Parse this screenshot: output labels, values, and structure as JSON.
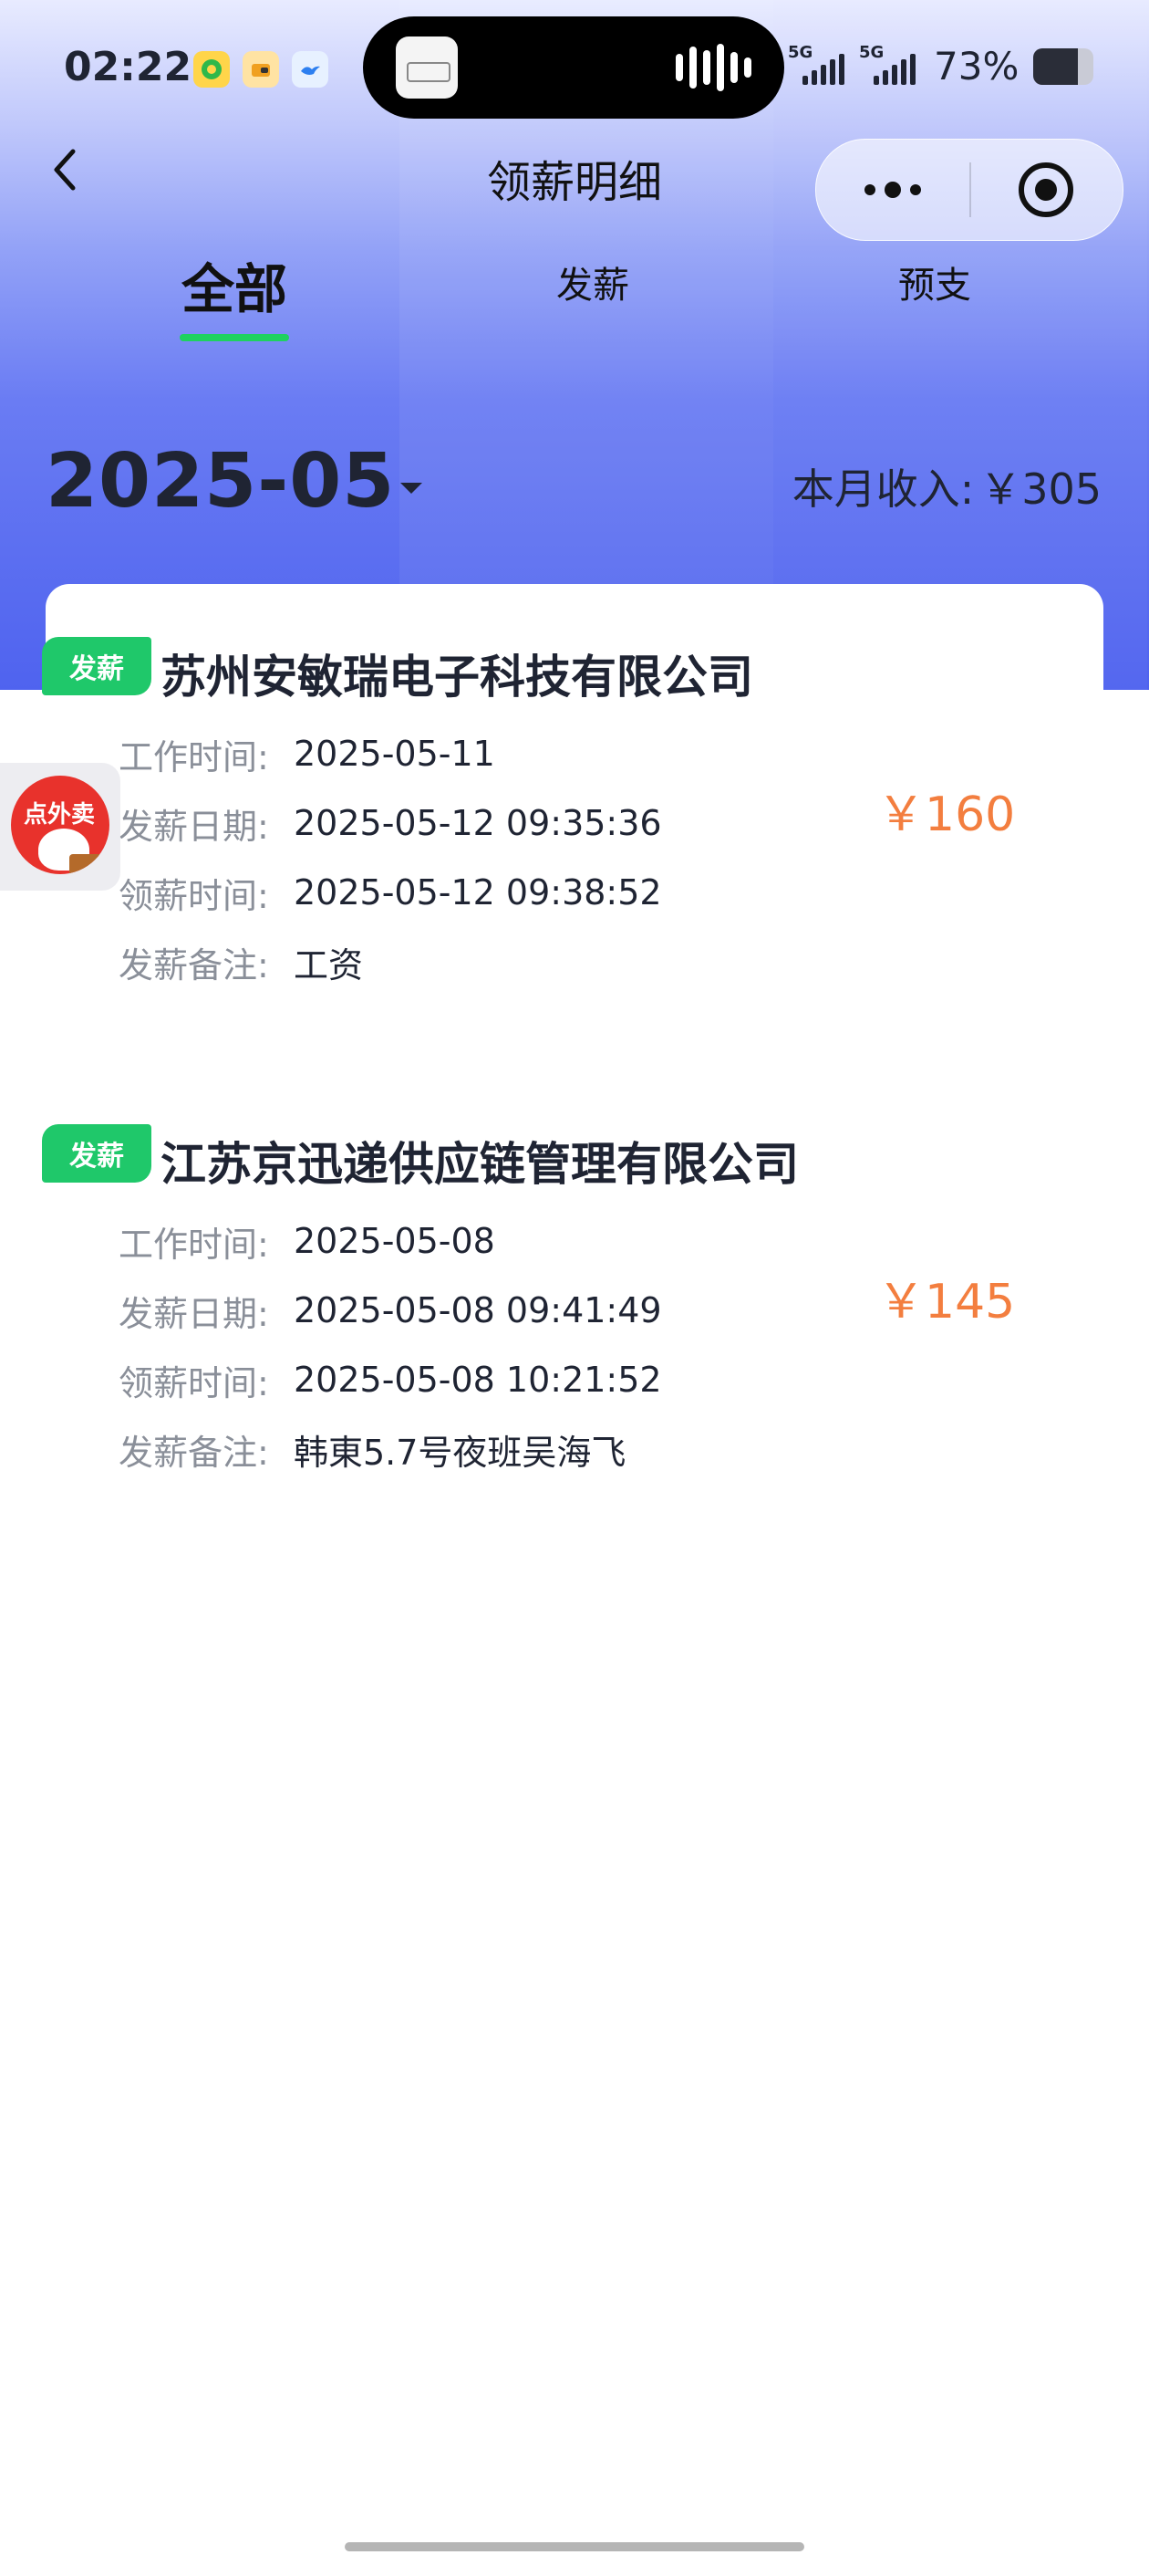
{
  "status_bar": {
    "time": "02:22",
    "app_icons": [
      "music-app-icon",
      "wallet-app-icon",
      "bird-app-icon"
    ],
    "network_1": "5G",
    "network_2": "5G",
    "battery_level": 0.73,
    "battery_text": "73%"
  },
  "nav": {
    "title": "领薪明细",
    "back_icon": "chevron-left-icon",
    "more_icon": "more-dots-icon",
    "close_icon": "target-close-icon"
  },
  "tabs": [
    {
      "label": "全部",
      "active": true
    },
    {
      "label": "发薪",
      "active": false
    },
    {
      "label": "预支",
      "active": false
    }
  ],
  "month": {
    "label": "2025-05",
    "income_label": "本月收入:",
    "income_value": "￥305"
  },
  "floating_ad": {
    "label": "点外卖"
  },
  "records": [
    {
      "badge": "发薪",
      "company": "苏州安敏瑞电子科技有限公司",
      "rows": [
        {
          "key": "工作时间:",
          "value": "2025-05-11"
        },
        {
          "key": "发薪日期:",
          "value": "2025-05-12 09:35:36"
        },
        {
          "key": "领薪时间:",
          "value": "2025-05-12 09:38:52"
        },
        {
          "key": "发薪备注:",
          "value": "工资"
        }
      ],
      "amount": "￥160"
    },
    {
      "badge": "发薪",
      "company": "江苏京迅递供应链管理有限公司",
      "rows": [
        {
          "key": "工作时间:",
          "value": "2025-05-08"
        },
        {
          "key": "发薪日期:",
          "value": "2025-05-08 09:41:49"
        },
        {
          "key": "领薪时间:",
          "value": "2025-05-08 10:21:52"
        },
        {
          "key": "发薪备注:",
          "value": "韩東5.7号夜班吴海飞"
        }
      ],
      "amount": "￥145"
    }
  ],
  "colors": {
    "accent_green": "#1ed15f",
    "badge_green": "#1fc86a",
    "amount_orange": "#f37e3f",
    "header_blue": "#4f63ef"
  }
}
